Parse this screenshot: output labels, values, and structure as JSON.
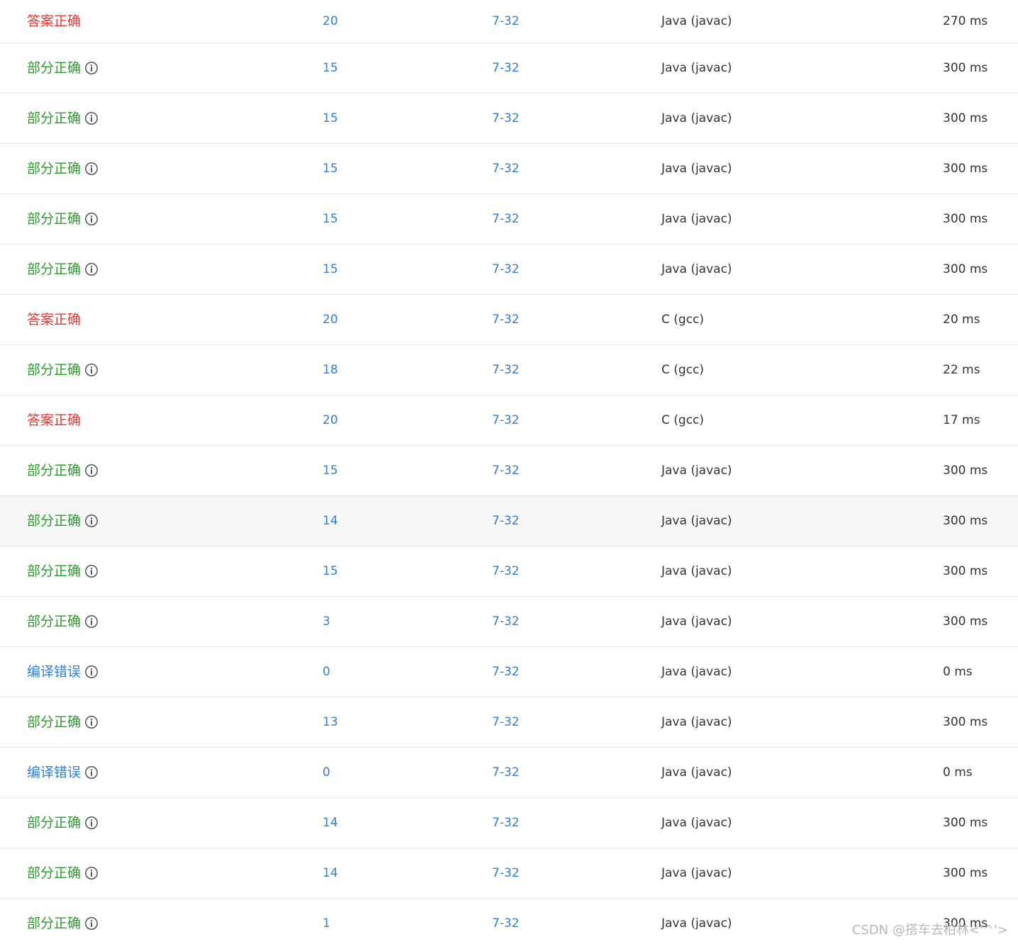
{
  "rows": [
    {
      "status": "答案正确",
      "status_type": "accepted",
      "info": false,
      "score": "20",
      "problem": "7-32",
      "language": "Java (javac)",
      "time": "270 ms"
    },
    {
      "status": "部分正确",
      "status_type": "partial",
      "info": true,
      "score": "15",
      "problem": "7-32",
      "language": "Java (javac)",
      "time": "300 ms"
    },
    {
      "status": "部分正确",
      "status_type": "partial",
      "info": true,
      "score": "15",
      "problem": "7-32",
      "language": "Java (javac)",
      "time": "300 ms"
    },
    {
      "status": "部分正确",
      "status_type": "partial",
      "info": true,
      "score": "15",
      "problem": "7-32",
      "language": "Java (javac)",
      "time": "300 ms"
    },
    {
      "status": "部分正确",
      "status_type": "partial",
      "info": true,
      "score": "15",
      "problem": "7-32",
      "language": "Java (javac)",
      "time": "300 ms"
    },
    {
      "status": "部分正确",
      "status_type": "partial",
      "info": true,
      "score": "15",
      "problem": "7-32",
      "language": "Java (javac)",
      "time": "300 ms"
    },
    {
      "status": "答案正确",
      "status_type": "accepted",
      "info": false,
      "score": "20",
      "problem": "7-32",
      "language": "C (gcc)",
      "time": "20 ms"
    },
    {
      "status": "部分正确",
      "status_type": "partial",
      "info": true,
      "score": "18",
      "problem": "7-32",
      "language": "C (gcc)",
      "time": "22 ms"
    },
    {
      "status": "答案正确",
      "status_type": "accepted",
      "info": false,
      "score": "20",
      "problem": "7-32",
      "language": "C (gcc)",
      "time": "17 ms"
    },
    {
      "status": "部分正确",
      "status_type": "partial",
      "info": true,
      "score": "15",
      "problem": "7-32",
      "language": "Java (javac)",
      "time": "300 ms"
    },
    {
      "status": "部分正确",
      "status_type": "partial",
      "info": true,
      "score": "14",
      "problem": "7-32",
      "language": "Java (javac)",
      "time": "300 ms",
      "hover": true
    },
    {
      "status": "部分正确",
      "status_type": "partial",
      "info": true,
      "score": "15",
      "problem": "7-32",
      "language": "Java (javac)",
      "time": "300 ms"
    },
    {
      "status": "部分正确",
      "status_type": "partial",
      "info": true,
      "score": "3",
      "problem": "7-32",
      "language": "Java (javac)",
      "time": "300 ms"
    },
    {
      "status": "编译错误",
      "status_type": "compile",
      "info": true,
      "score": "0",
      "problem": "7-32",
      "language": "Java (javac)",
      "time": "0 ms"
    },
    {
      "status": "部分正确",
      "status_type": "partial",
      "info": true,
      "score": "13",
      "problem": "7-32",
      "language": "Java (javac)",
      "time": "300 ms"
    },
    {
      "status": "编译错误",
      "status_type": "compile",
      "info": true,
      "score": "0",
      "problem": "7-32",
      "language": "Java (javac)",
      "time": "0 ms"
    },
    {
      "status": "部分正确",
      "status_type": "partial",
      "info": true,
      "score": "14",
      "problem": "7-32",
      "language": "Java (javac)",
      "time": "300 ms"
    },
    {
      "status": "部分正确",
      "status_type": "partial",
      "info": true,
      "score": "14",
      "problem": "7-32",
      "language": "Java (javac)",
      "time": "300 ms"
    },
    {
      "status": "部分正确",
      "status_type": "partial",
      "info": true,
      "score": "1",
      "problem": "7-32",
      "language": "Java (javac)",
      "time": "300 ms"
    }
  ],
  "icons": {
    "info": "info-circle-icon"
  },
  "colors": {
    "accepted": "#e53935",
    "partial": "#2e9b2e",
    "compile": "#2f7fd6",
    "link": "#2f7fd6",
    "text": "#333333",
    "border": "#e6e6e6",
    "hover_bg": "#f7f7f7"
  },
  "watermark": "CSDN @搭车去柏林<'^'>"
}
